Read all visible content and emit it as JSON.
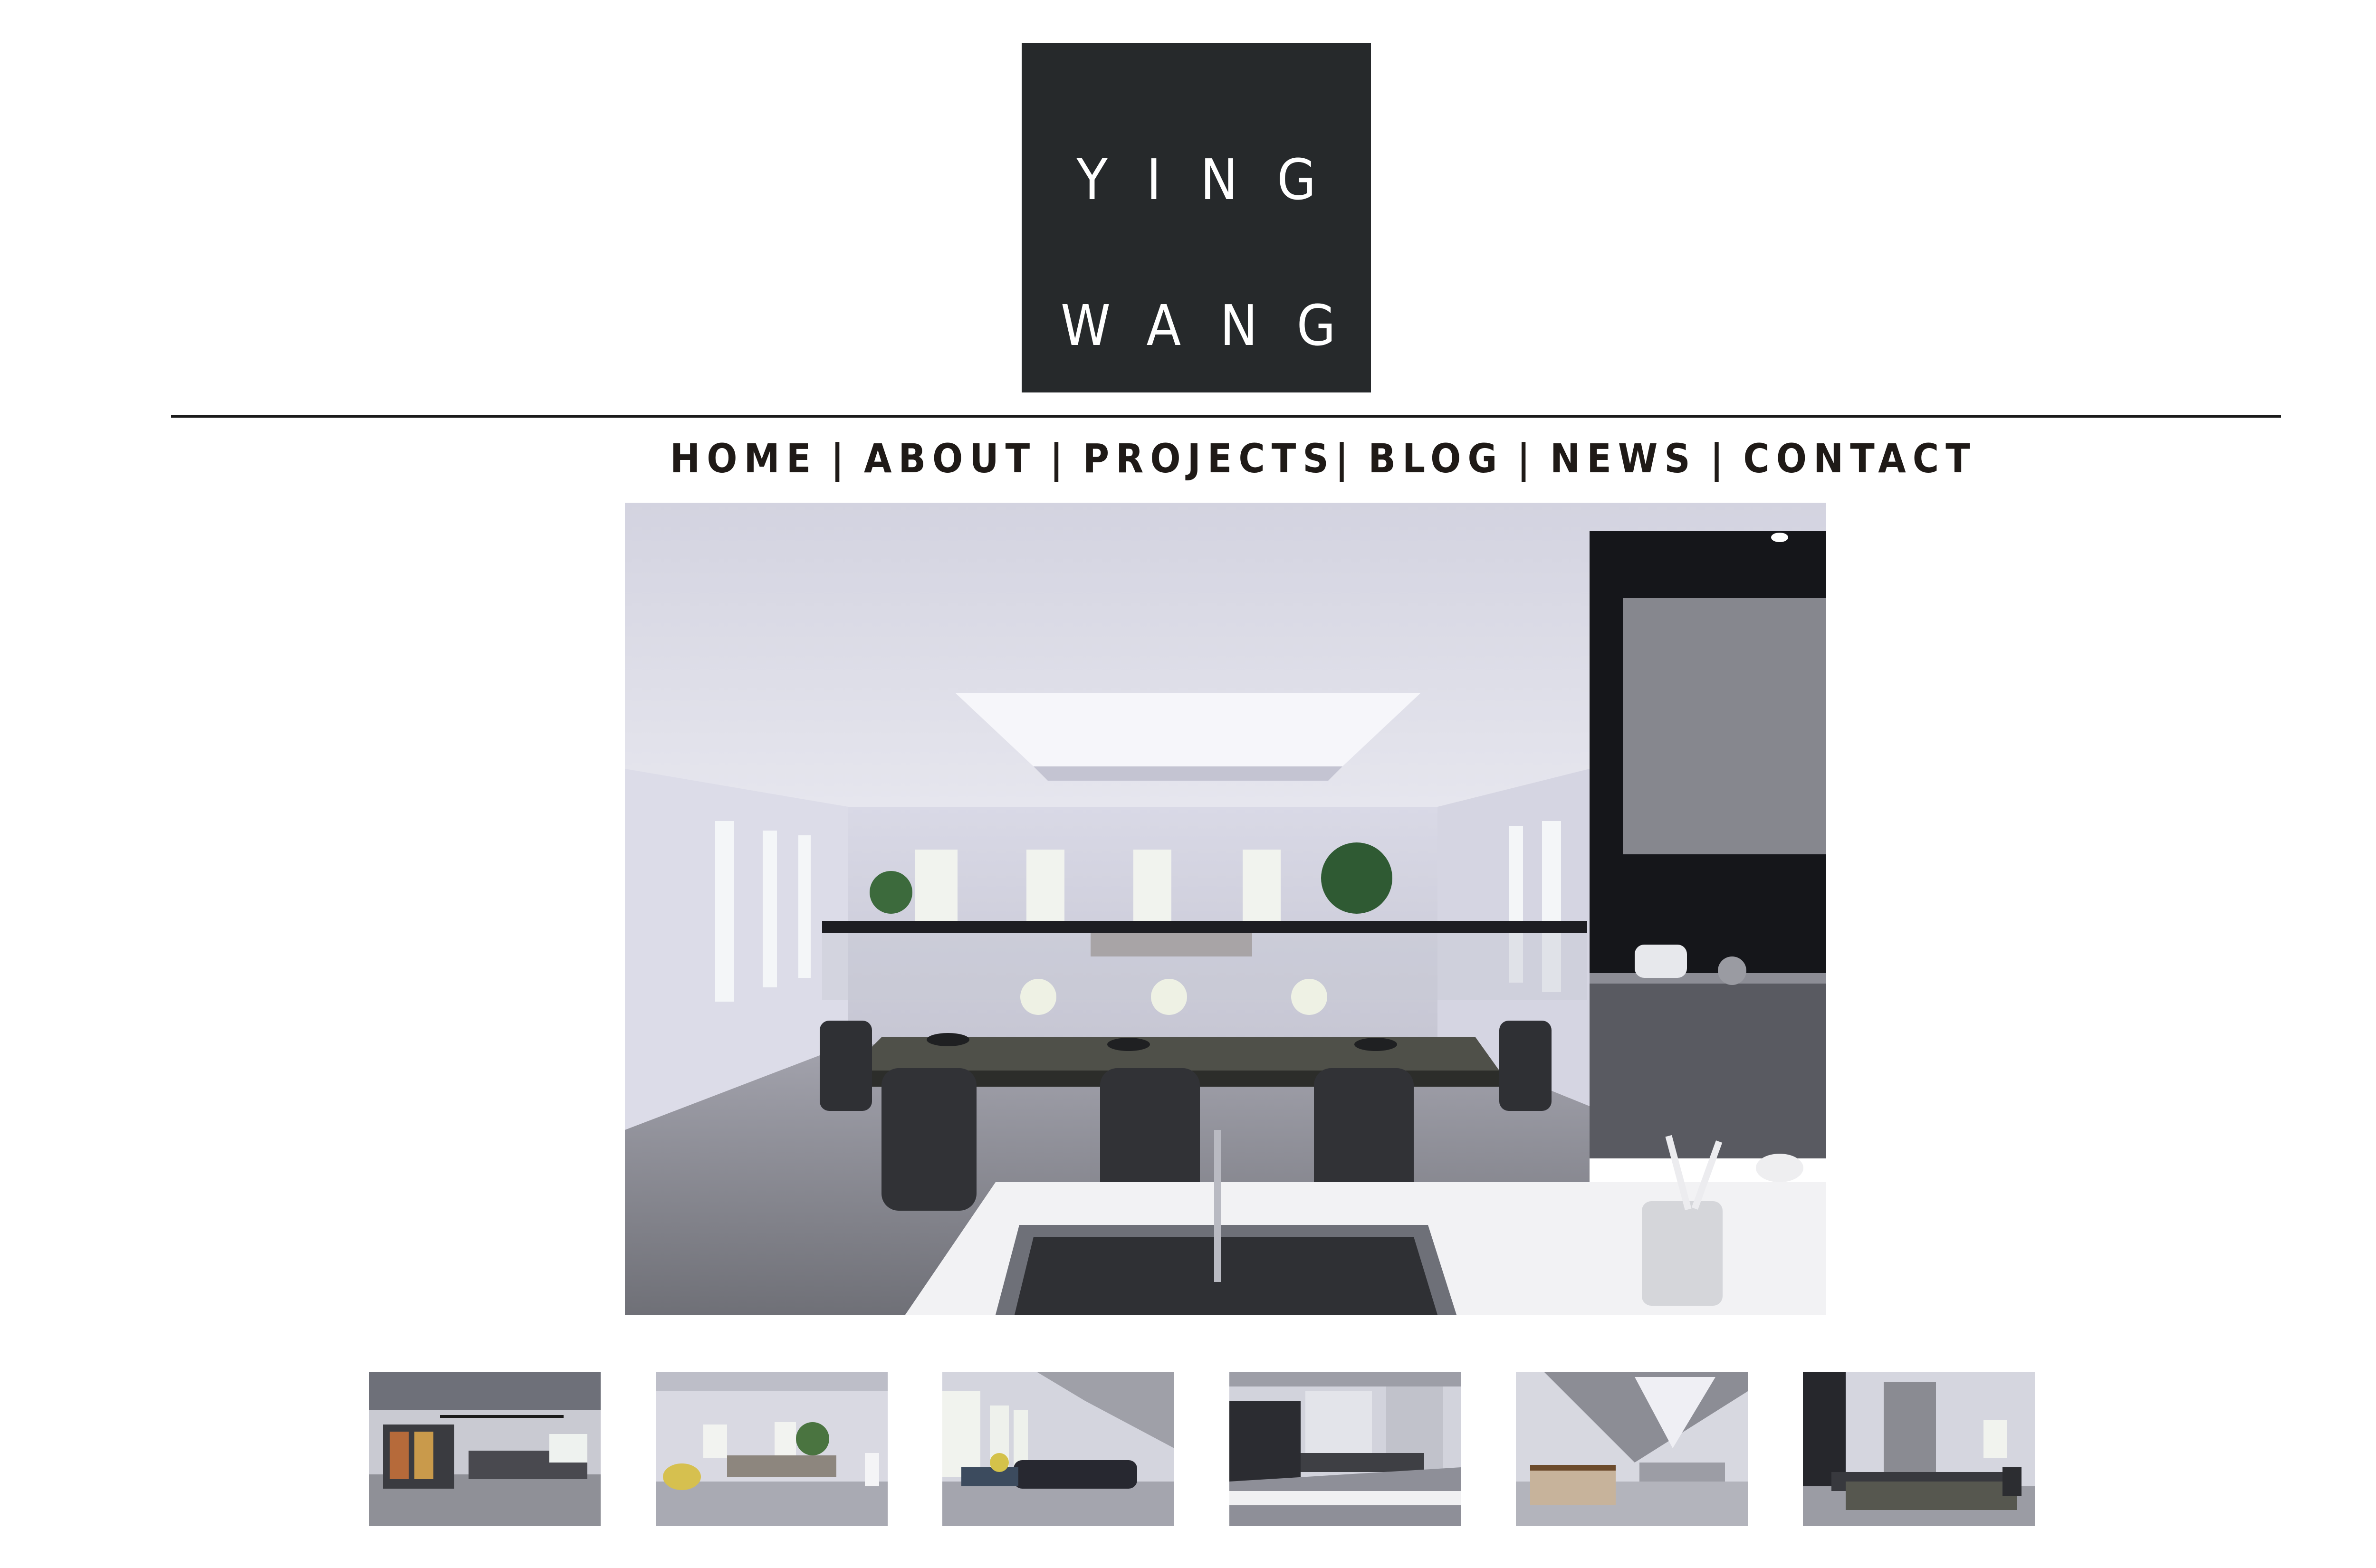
{
  "logo": {
    "line1": "YING",
    "line2": "WANG",
    "background_color": "#26292b",
    "text_color": "#ffffff"
  },
  "nav": {
    "items": [
      {
        "label": "HOME"
      },
      {
        "label": "ABOUT"
      },
      {
        "label": "PROJECTS"
      },
      {
        "label": "BLOG"
      },
      {
        "label": "NEWS"
      },
      {
        "label": "CONTACT"
      }
    ],
    "separator": "|",
    "text_color": "#1f1a17"
  },
  "hero": {
    "subject": "interior rendering - kitchen and dining area with skylight"
  },
  "gallery": {
    "thumbnails": [
      {
        "subject": "bar area with wine cabinets"
      },
      {
        "subject": "living room with sofa"
      },
      {
        "subject": "lounge with window wall"
      },
      {
        "subject": "kitchen and dining overview"
      },
      {
        "subject": "stair and reception area"
      },
      {
        "subject": "dining room with fireplace"
      }
    ]
  }
}
